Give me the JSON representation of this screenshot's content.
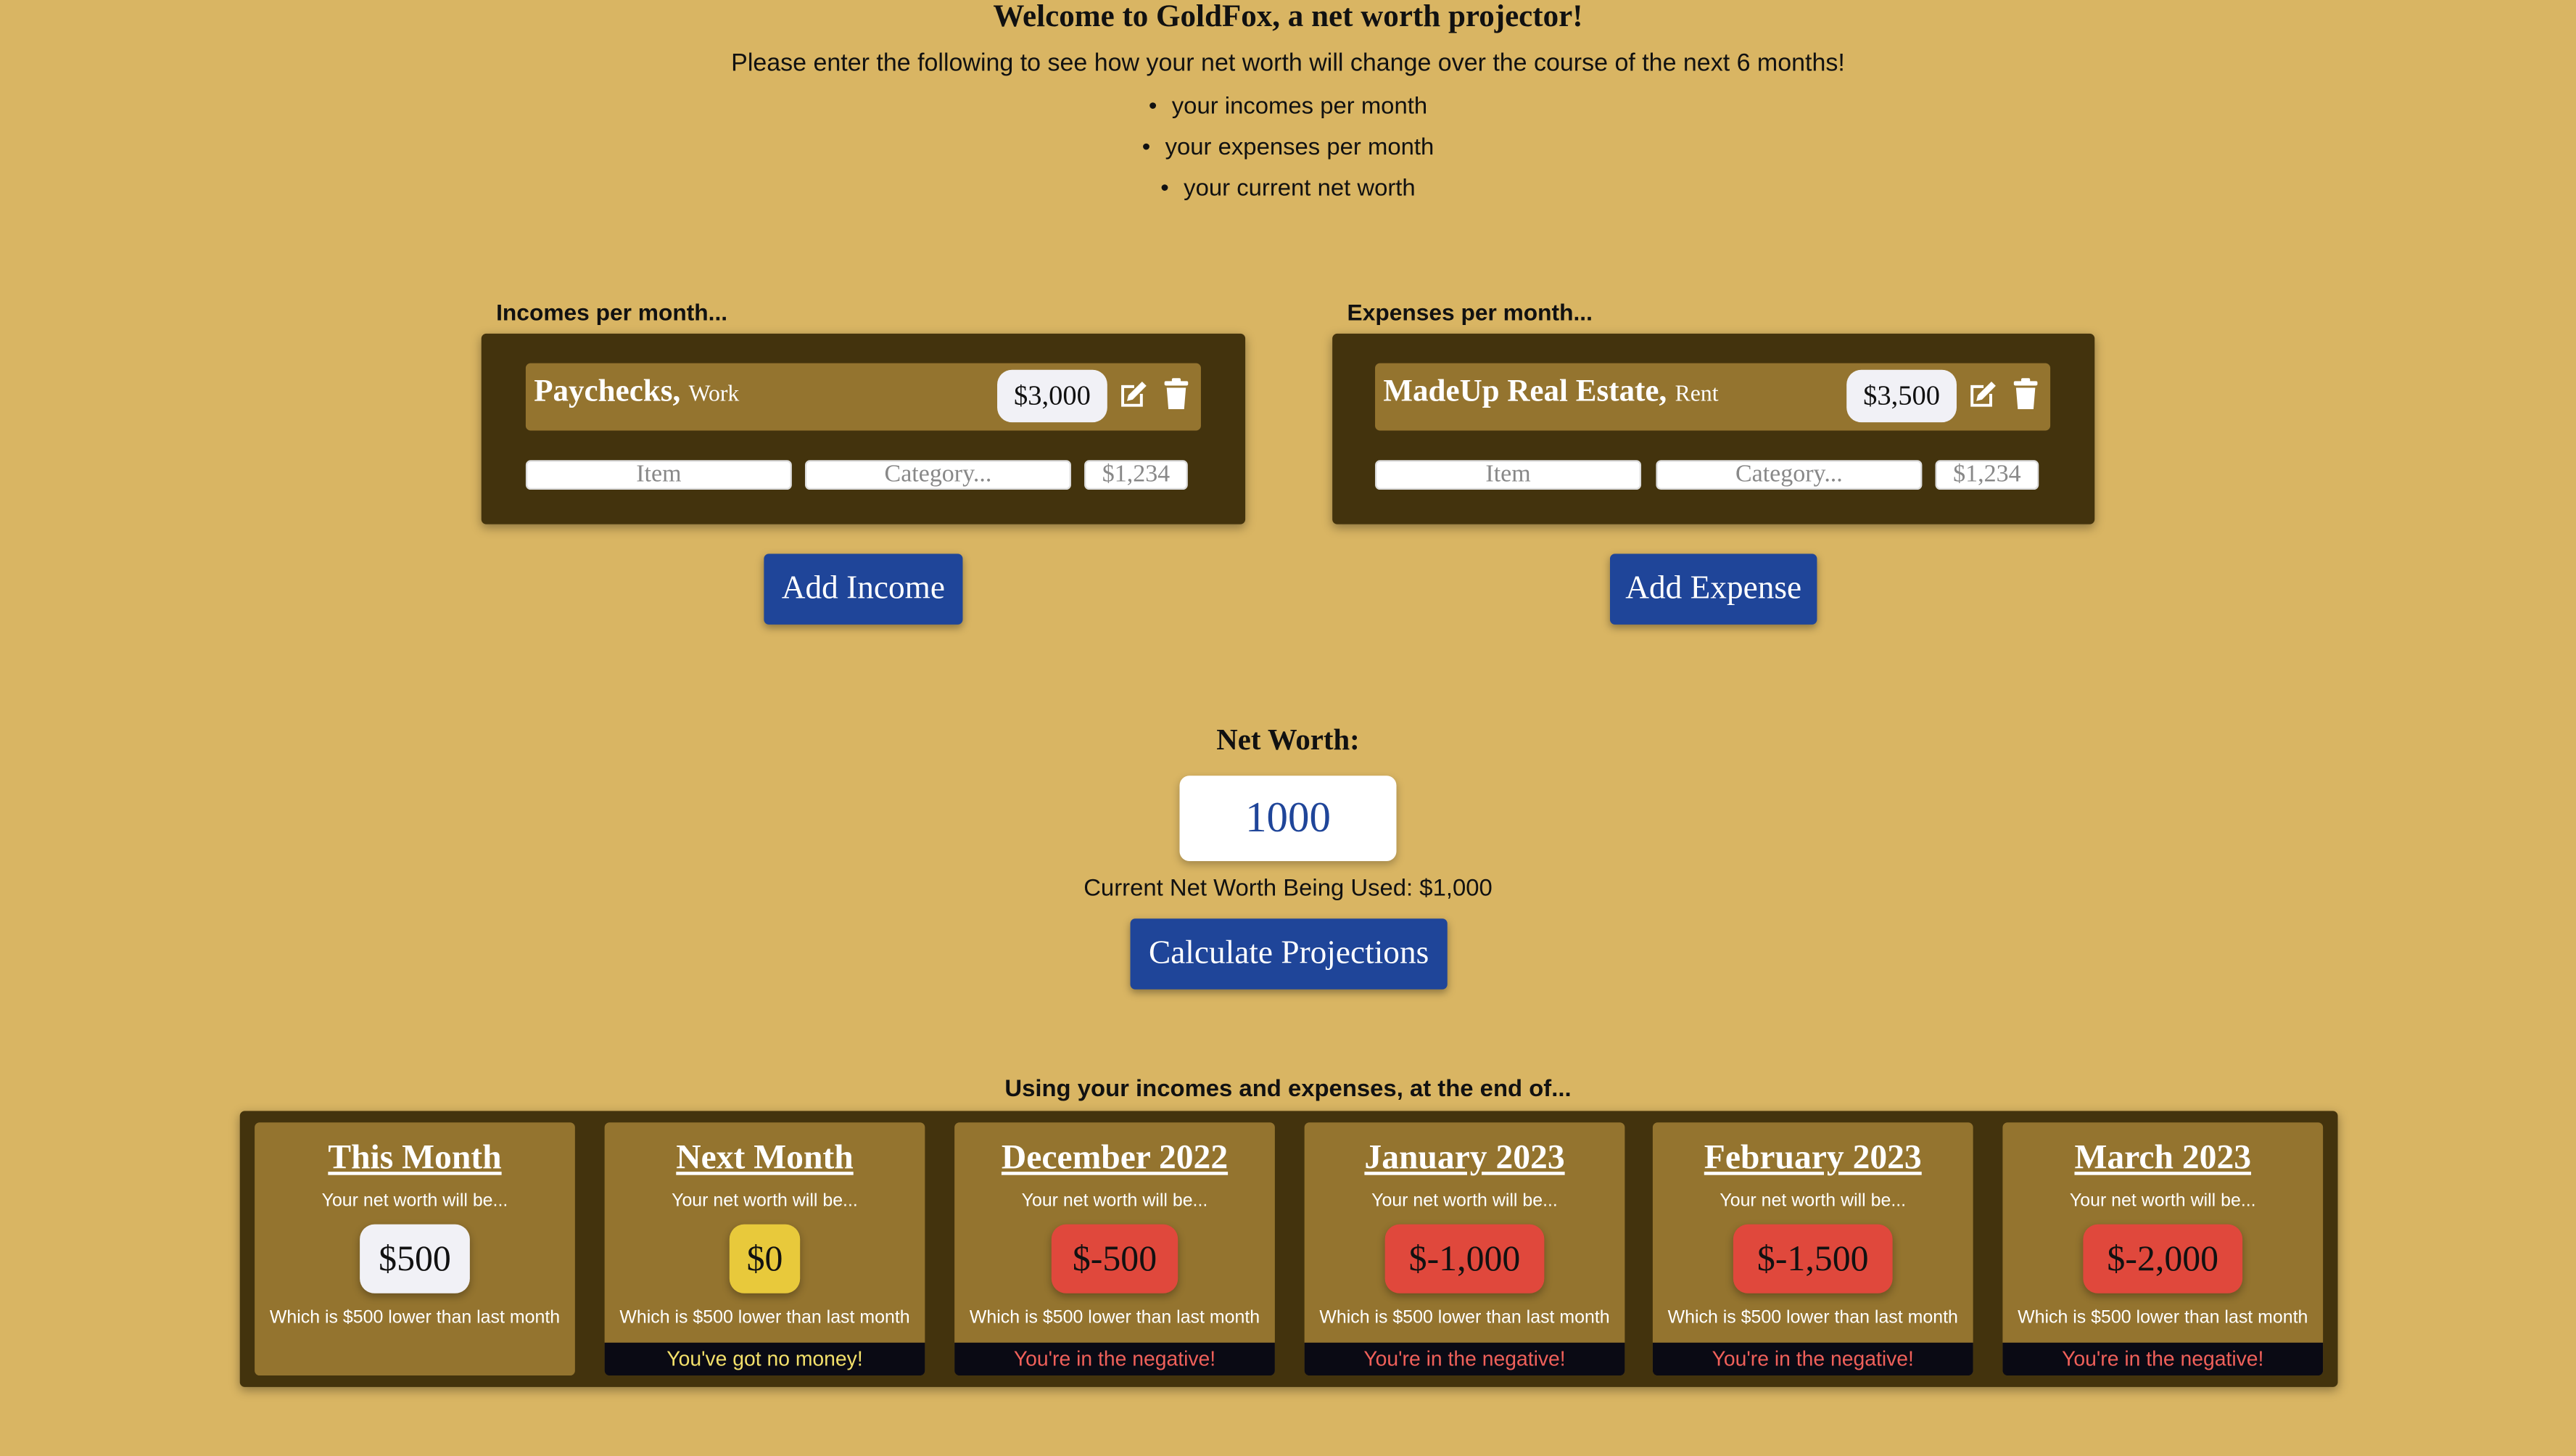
{
  "header": {
    "title": "Welcome to GoldFox, a net worth projector!",
    "subtitle": "Please enter the following to see how your net worth will change over the course of the next 6 months!",
    "requirements": [
      "your incomes per month",
      "your expenses per month",
      "your current net worth"
    ]
  },
  "incomes": {
    "label": "Incomes per month...",
    "entries": [
      {
        "name": "Paychecks",
        "separator": ",",
        "category": "Work",
        "amount": "$3,000",
        "icons": [
          "edit-icon",
          "trash-icon"
        ]
      }
    ],
    "form": {
      "item_placeholder": "Item",
      "category_placeholder": "Category...",
      "amount_placeholder": "$1,234"
    },
    "add_button": "Add Income"
  },
  "expenses": {
    "label": "Expenses per month...",
    "entries": [
      {
        "name": "MadeUp Real Estate",
        "separator": ",",
        "category": "Rent",
        "amount": "$3,500",
        "icons": [
          "edit-icon",
          "trash-icon"
        ]
      }
    ],
    "form": {
      "item_placeholder": "Item",
      "category_placeholder": "Category...",
      "amount_placeholder": "$1,234"
    },
    "add_button": "Add Expense"
  },
  "net_worth": {
    "label": "Net Worth:",
    "value": "1000",
    "current_used": "Current Net Worth Being Used: $1,000",
    "calculate_button": "Calculate Projections"
  },
  "projections": {
    "label": "Using your incomes and expenses, at the end of...",
    "cards": [
      {
        "title": "This Month",
        "subtitle": "Your net worth will be...",
        "value": "$500",
        "note": "Which is $500 lower than last month",
        "status": "",
        "value_color": "#f1f1f6",
        "status_color": ""
      },
      {
        "title": "Next Month",
        "subtitle": "Your net worth will be...",
        "value": "$0",
        "note": "Which is $500 lower than last month",
        "status": "You've got no money!",
        "value_color": "#e8c93b",
        "status_color": "#f3e06a"
      },
      {
        "title": "December 2022",
        "subtitle": "Your net worth will be...",
        "value": "$-500",
        "note": "Which is $500 lower than last month",
        "status": "You're in the negative!",
        "value_color": "#e0483c",
        "status_color": "#f0605a"
      },
      {
        "title": "January 2023",
        "subtitle": "Your net worth will be...",
        "value": "$-1,000",
        "note": "Which is $500 lower than last month",
        "status": "You're in the negative!",
        "value_color": "#e0483c",
        "status_color": "#f0605a"
      },
      {
        "title": "February 2023",
        "subtitle": "Your net worth will be...",
        "value": "$-1,500",
        "note": "Which is $500 lower than last month",
        "status": "You're in the negative!",
        "value_color": "#e0483c",
        "status_color": "#f0605a"
      },
      {
        "title": "March 2023",
        "subtitle": "Your net worth will be...",
        "value": "$-2,000",
        "note": "Which is $500 lower than last month",
        "status": "You're in the negative!",
        "value_color": "#e0483c",
        "status_color": "#f0605a"
      }
    ]
  },
  "colors": {
    "background": "#d9b563",
    "panel": "#43330d",
    "card": "#94742f",
    "button": "#1f4599"
  }
}
